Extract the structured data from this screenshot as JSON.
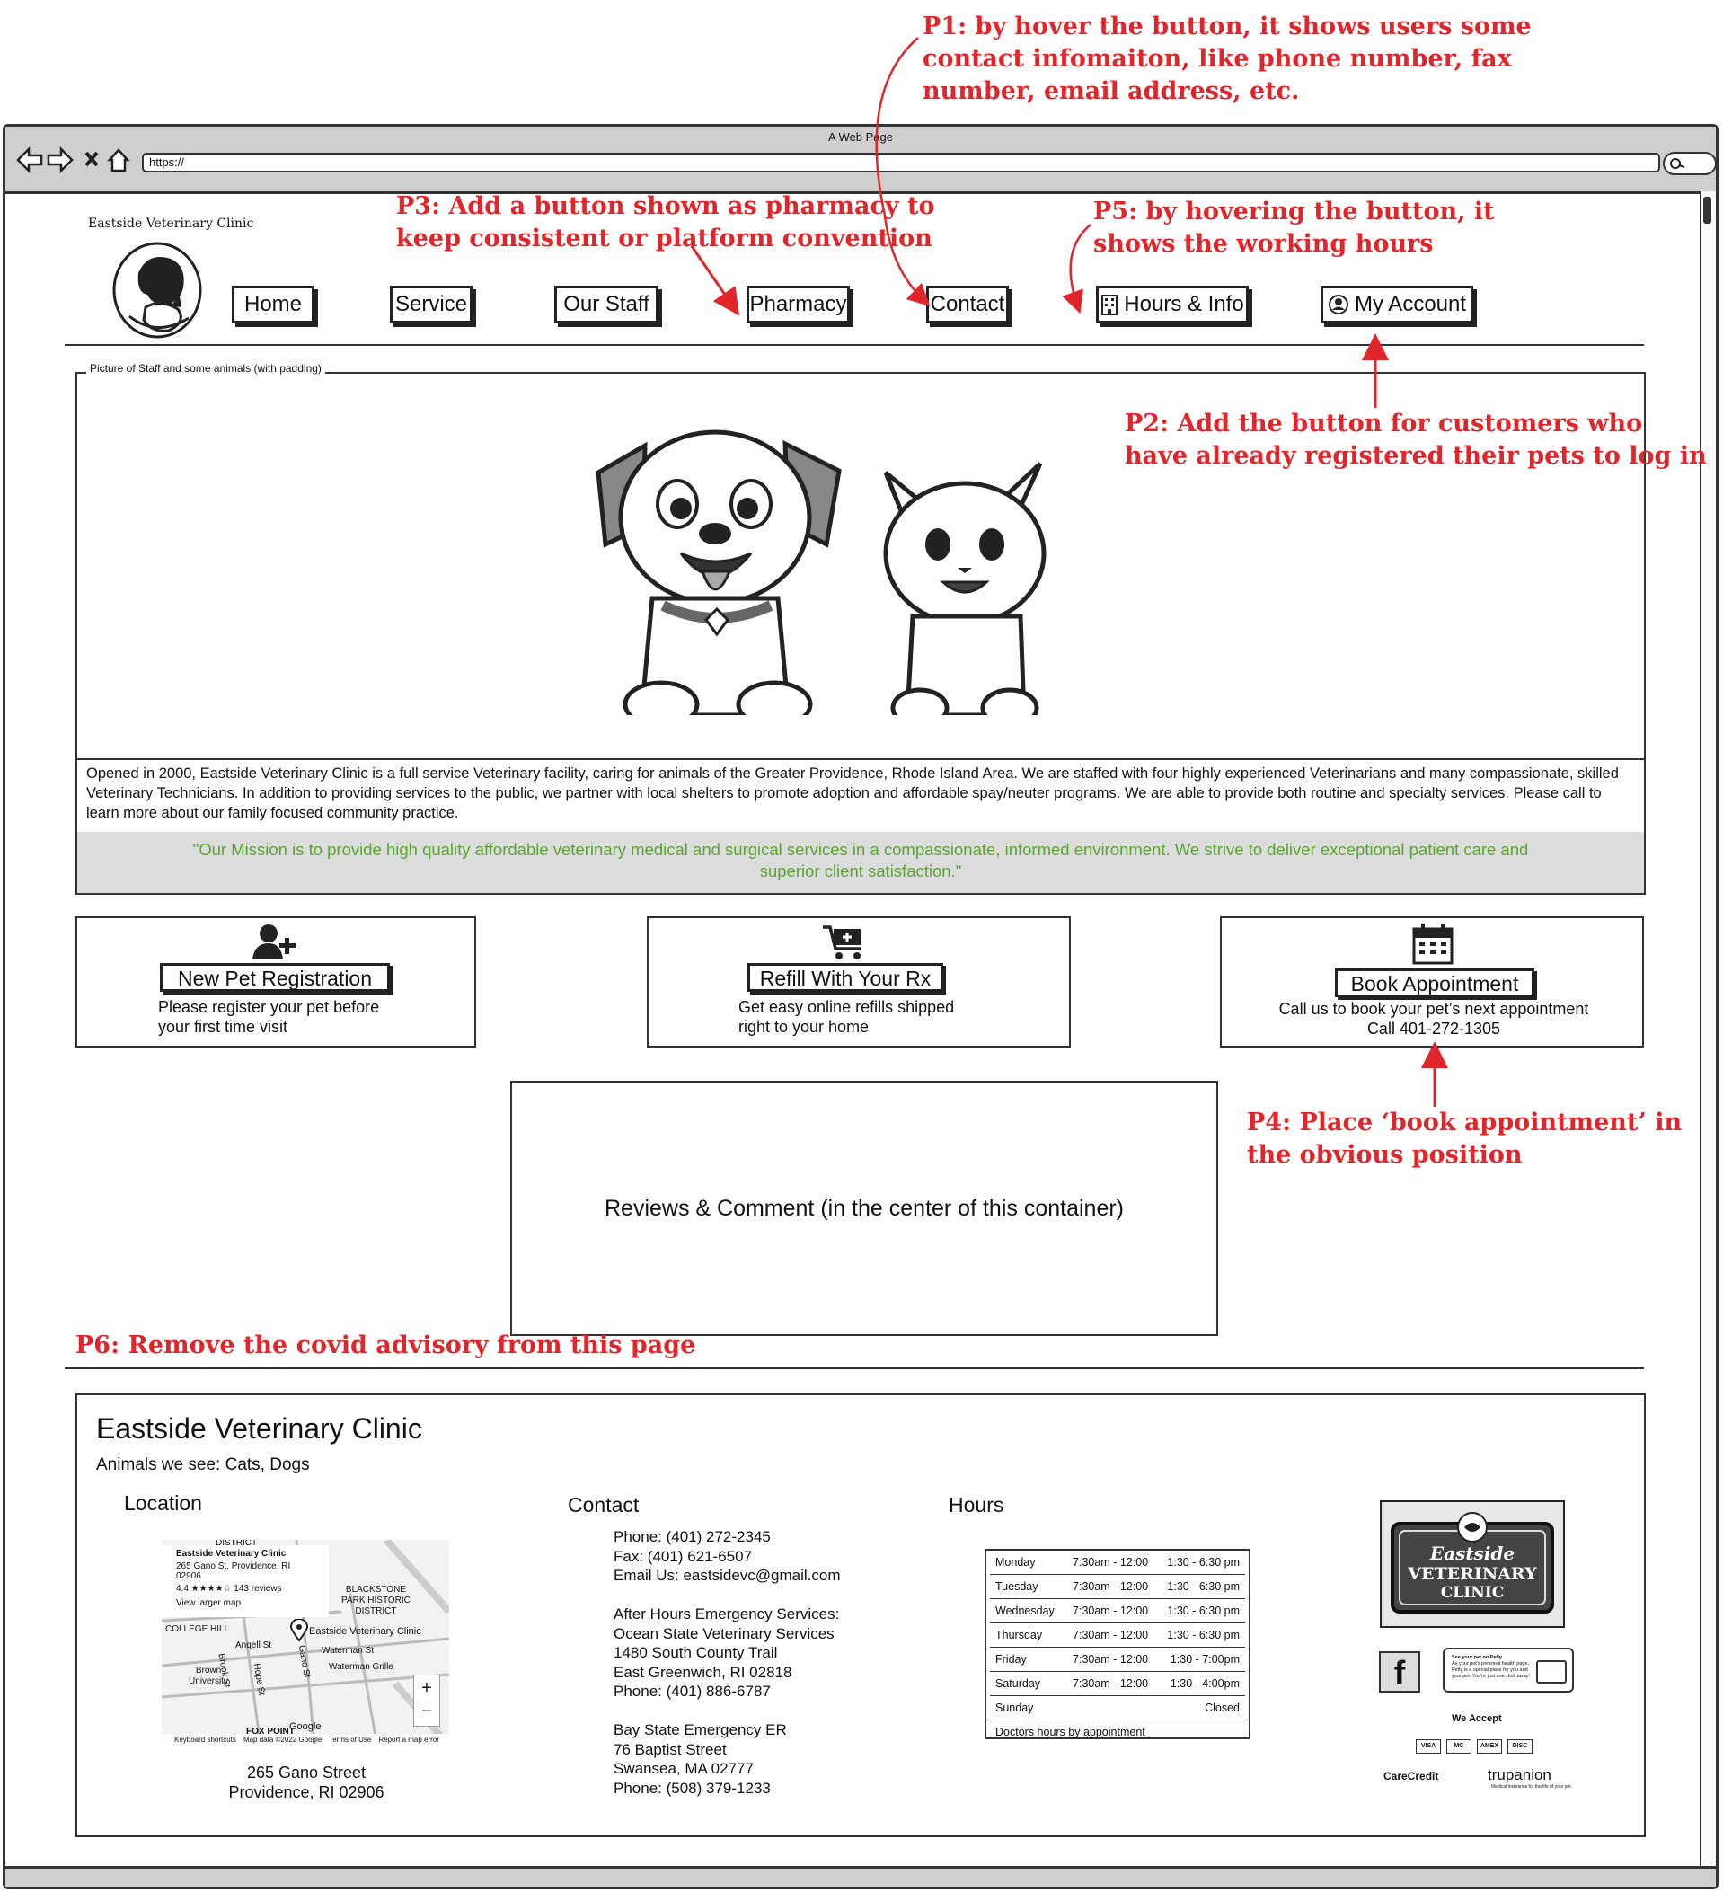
{
  "annotations": {
    "p1": [
      "P1: by hover the button, it shows users some",
      "contact infomaiton, like phone number, fax",
      "number, email address, etc."
    ],
    "p2": [
      "P2: Add the button for customers who",
      "have already registered their pets to log in"
    ],
    "p3": [
      "P3: Add a button shown as pharmacy to",
      "keep consistent or platform convention"
    ],
    "p4": [
      "P4: Place ‘book appointment’ in",
      "the obvious position"
    ],
    "p5": [
      "P5: by hovering the button, it",
      "shows the working hours"
    ],
    "p6": "P6: Remove the covid advisory from this page"
  },
  "browser": {
    "window_title": "A Web Page",
    "url": "https://"
  },
  "header": {
    "clinic_name": "Eastside Veterinary Clinic",
    "nav": [
      "Home",
      "Service",
      "Our Staff",
      "Pharmacy",
      "Contact",
      "Hours & Info",
      "My Account"
    ]
  },
  "hero": {
    "caption": "Picture of Staff and some animals (with padding)",
    "about": "Opened in 2000, Eastside Veterinary Clinic is a full service Veterinary facility, caring for animals of the Greater Providence, Rhode Island Area. We are staffed with four highly experienced Veterinarians and many compassionate, skilled Veterinary Technicians. In addition to providing services to the public, we partner with local shelters to promote adoption and affordable spay/neuter programs. We are able to provide both routine and specialty services. Please call to learn more about our family focused  community practice.",
    "mission": "\"Our Mission is to provide high quality affordable veterinary medical and surgical services in a compassionate, informed environment. We strive to deliver exceptional patient care and superior client satisfaction.\""
  },
  "cards": [
    {
      "button": "New Pet Registration",
      "lines": [
        "Please register your pet before",
        "your first time visit"
      ]
    },
    {
      "button": "Refill With Your Rx",
      "lines": [
        "Get easy online refills shipped",
        "right to your home"
      ]
    },
    {
      "button": "Book Appointment",
      "lines": [
        "Call us to book your pet’s next appointment",
        "Call 401-272-1305"
      ]
    }
  ],
  "reviews": {
    "text": "Reviews & Comment (in the center of this container)"
  },
  "footer": {
    "title": "Eastside Veterinary Clinic",
    "animals": "Animals we see: Cats, Dogs",
    "location": {
      "heading": "Location",
      "map": {
        "district_top": "DISTRICT",
        "place_name": "Eastside Veterinary Clinic",
        "place_address": "265 Gano St, Providence, RI 02906",
        "rating": "4.4 ★★★★☆  143 reviews",
        "larger_map": "View larger map",
        "labels": [
          "BLACKSTONE",
          "PARK HISTORIC",
          "DISTRICT",
          "COLLEGE HILL",
          "Eastside Veterinary Clinic",
          "Brown University",
          "Waterman Grille",
          "Angell St",
          "Waterman St",
          "Hope St",
          "Brook St",
          "Gano St",
          "FOX POINT"
        ],
        "google": "Google",
        "footer_links": [
          "Keyboard shortcuts",
          "Map data ©2022 Google",
          "Terms of Use",
          "Report a map error"
        ],
        "zoom_in": "+",
        "zoom_out": "−"
      },
      "address_line1": "265 Gano Street",
      "address_line2": "Providence, RI  02906"
    },
    "contact": {
      "heading": "Contact",
      "lines": [
        "Phone: (401) 272-2345",
        "Fax: (401) 621-6507",
        "Email Us: eastsidevc@gmail.com",
        "",
        "After Hours Emergency Services:",
        "Ocean State Veterinary Services",
        "1480 South County Trail",
        "East Greenwich, RI 02818",
        "Phone: (401) 886-6787",
        "",
        "Bay State Emergency ER",
        "76 Baptist Street",
        "Swansea, MA 02777",
        "Phone: (508) 379-1233"
      ]
    },
    "hours": {
      "heading": "Hours",
      "rows": [
        [
          "Monday",
          "7:30am - 12:00",
          "1:30 - 6:30 pm"
        ],
        [
          "Tuesday",
          "7:30am - 12:00",
          "1:30 - 6:30 pm"
        ],
        [
          "Wednesday",
          "7:30am - 12:00",
          "1:30 - 6:30 pm"
        ],
        [
          "Thursday",
          "7:30am - 12:00",
          "1:30 - 6:30 pm"
        ],
        [
          "Friday",
          "7:30am - 12:00",
          "1:30 - 7:00pm"
        ],
        [
          "Saturday",
          "7:30am - 12:00",
          "1:30 - 4:00pm"
        ],
        [
          "Sunday",
          "",
          "Closed"
        ]
      ],
      "note": "Doctors hours by appointment"
    },
    "badges": {
      "sign": [
        "Eastside",
        "VETERINARY",
        "CLINIC"
      ],
      "facebook": "f",
      "petly": [
        "See your pet on Petly",
        "As your pet's personal health page,",
        "Petly is a special place for you and",
        "your pet. You're just one click away!"
      ],
      "we_accept": "We Accept",
      "cards": [
        "VISA",
        "MC",
        "AMEX",
        "DISC"
      ],
      "carecredit": "CareCredit",
      "trupanion": "trupanion",
      "trupanion_tag": "Medical insurance for the life of your pet."
    }
  }
}
